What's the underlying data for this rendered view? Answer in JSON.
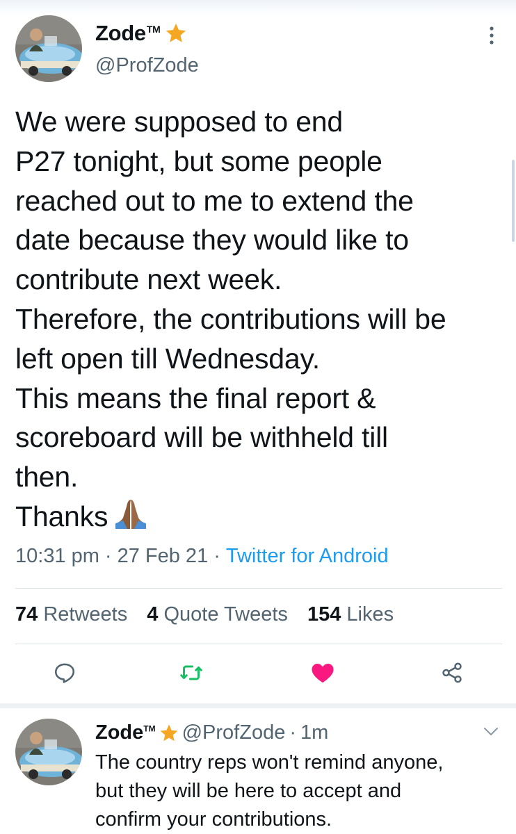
{
  "tweet": {
    "author": {
      "display_name": "Zode",
      "tm": "TM",
      "handle": "@ProfZode",
      "badge_icon": "star-icon"
    },
    "text_lines": [
      "We were supposed to end",
      "P27 tonight, but some people",
      "reached out to me to extend the",
      "date because they would like to",
      "contribute next week.",
      "Therefore, the contributions will be",
      "left open till Wednesday.",
      "This means the final report &",
      "scoreboard will be withheld till",
      "then.",
      "Thanks"
    ],
    "emoji": "folded-hands-icon",
    "time": "10:31 pm",
    "date": "27 Feb 21",
    "separator": "·",
    "source": "Twitter for Android",
    "stats": {
      "retweets_count": "74",
      "retweets_label": "Retweets",
      "quotes_count": "4",
      "quotes_label": "Quote Tweets",
      "likes_count": "154",
      "likes_label": "Likes"
    },
    "actions": [
      "reply-icon",
      "retweet-icon",
      "like-icon",
      "share-icon"
    ],
    "colors": {
      "accent": "#1d9bf0",
      "retweet": "#17bf63",
      "like": "#f91880",
      "muted": "#536471",
      "star": "#f5a623"
    }
  },
  "reply": {
    "display_name": "Zode",
    "tm": "TM",
    "handle": "@ProfZode",
    "separator": "·",
    "age": "1m",
    "text_lines": [
      "The country reps won't remind anyone,",
      "but they will be here to accept and",
      "confirm your contributions."
    ]
  }
}
